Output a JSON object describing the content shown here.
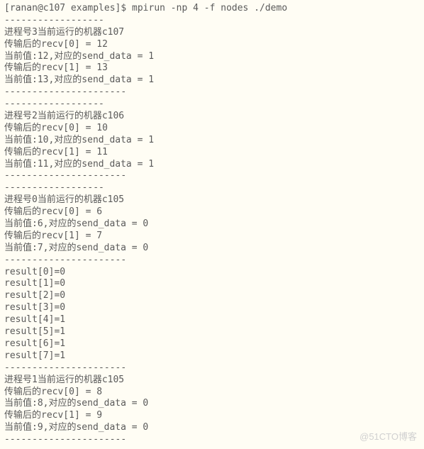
{
  "prompt": "[ranan@c107 examples]$ mpirun -np 4 -f nodes ./demo",
  "blocks": [
    {
      "sep_before": "------------------",
      "header": "进程号3当前运行的机器c107",
      "lines": [
        "传输后的recv[0] = 12",
        "当前值:12,对应的send_data = 1",
        "传输后的recv[1] = 13",
        "当前值:13,对应的send_data = 1"
      ],
      "sep_after": "----------------------"
    },
    {
      "sep_before": "------------------",
      "header": "进程号2当前运行的机器c106",
      "lines": [
        "传输后的recv[0] = 10",
        "当前值:10,对应的send_data = 1",
        "传输后的recv[1] = 11",
        "当前值:11,对应的send_data = 1"
      ],
      "sep_after": "----------------------"
    },
    {
      "sep_before": "------------------",
      "header": "进程号0当前运行的机器c105",
      "lines": [
        "传输后的recv[0] = 6",
        "当前值:6,对应的send_data = 0",
        "传输后的recv[1] = 7",
        "当前值:7,对应的send_data = 0"
      ],
      "sep_after": "----------------------"
    }
  ],
  "results": [
    "result[0]=0",
    "result[1]=0",
    "result[2]=0",
    "result[3]=0",
    "result[4]=1",
    "result[5]=1",
    "result[6]=1",
    "result[7]=1"
  ],
  "results_sep": "----------------------",
  "last_block": {
    "header": "进程号1当前运行的机器c105",
    "lines": [
      "传输后的recv[0] = 8",
      "当前值:8,对应的send_data = 0",
      "传输后的recv[1] = 9",
      "当前值:9,对应的send_data = 0"
    ],
    "sep_after": "----------------------"
  },
  "watermark": "@51CTO博客"
}
